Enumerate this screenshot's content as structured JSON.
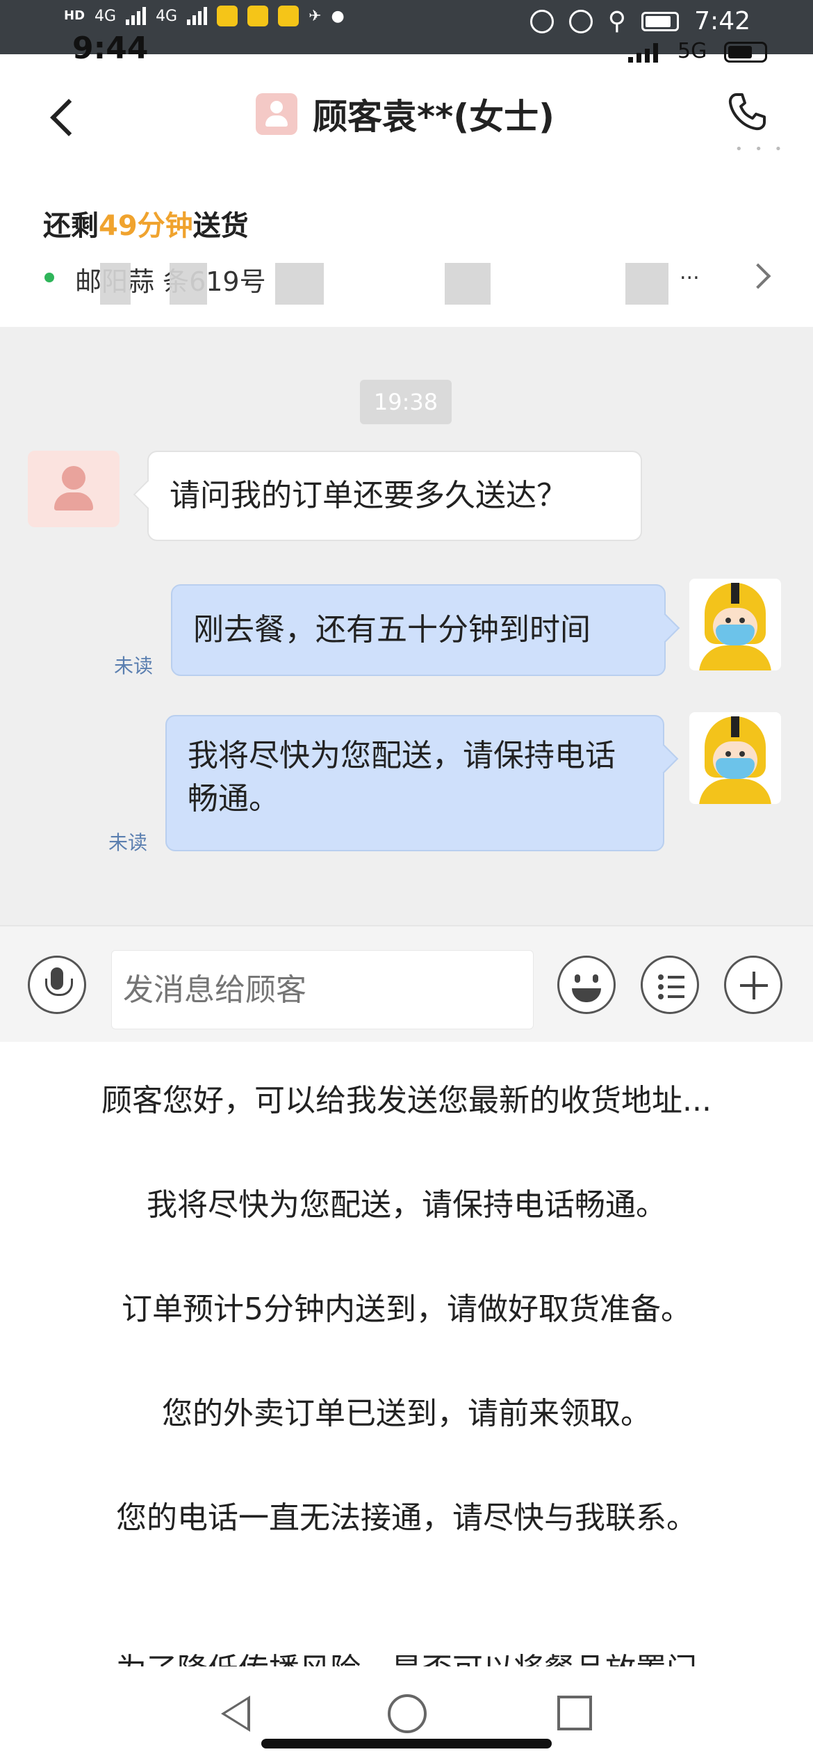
{
  "outer_status": {
    "hd": "HD",
    "net1": "4G",
    "net2": "4G",
    "time": "7:42"
  },
  "inner_status": {
    "time": "9:44",
    "network": "5G"
  },
  "header": {
    "title": "顾客袁**(女士)"
  },
  "order": {
    "remain_prefix": "还剩",
    "remain_highlight": "49分钟",
    "remain_suffix": "送货",
    "address_partial": "邮阳蒜           条619号",
    "more": "..."
  },
  "chat": {
    "timestamp": "19:38",
    "messages": [
      {
        "from": "customer",
        "text": "请问我的订单还要多久送达？"
      },
      {
        "from": "rider",
        "text": "刚去餐，还有五十分钟到时间",
        "status": "未读"
      },
      {
        "from": "rider",
        "text": "我将尽快为您配送，请保持电话畅通。",
        "status": "未读"
      }
    ]
  },
  "input": {
    "placeholder": "发消息给顾客"
  },
  "quick_replies": [
    "顾客您好，可以给我发送您最新的收货地址...",
    "我将尽快为您配送，请保持电话畅通。",
    "订单预计5分钟内送到，请做好取货准备。",
    "您的外卖订单已送到，请前来领取。",
    "您的电话一直无法接通，请尽快与我联系。",
    "为了降低传播风险，是否可以将餐品放置门"
  ],
  "colors": {
    "accent": "#f0a32e",
    "rider_bubble": "#cfe0fb",
    "unread_text": "#5b7fb0"
  }
}
